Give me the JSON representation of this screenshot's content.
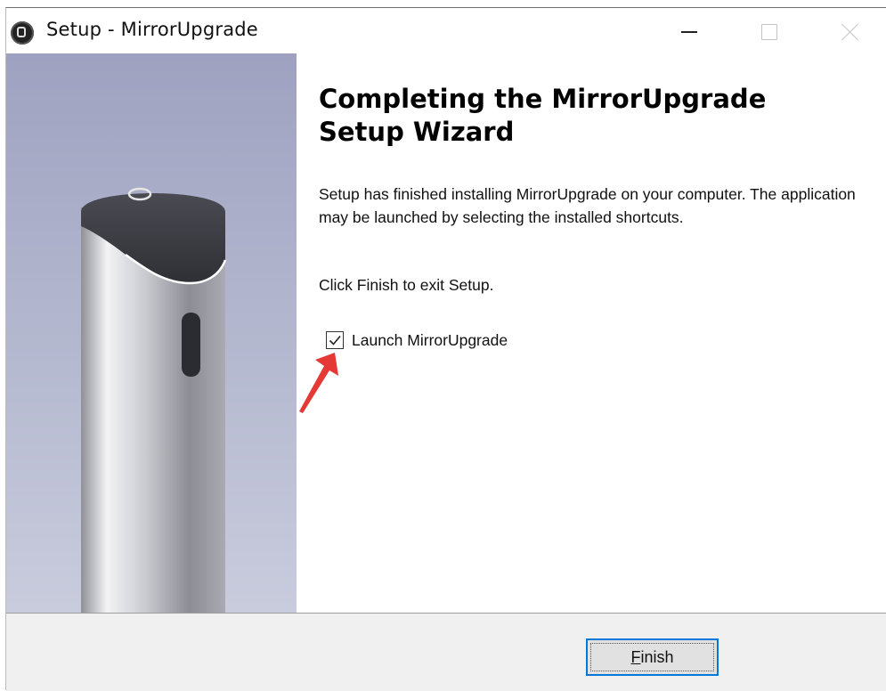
{
  "window": {
    "title": "Setup - MirrorUpgrade",
    "app_icon": "setup-app-icon",
    "controls": [
      "minimize-icon",
      "maximize-icon",
      "close-icon"
    ]
  },
  "main": {
    "heading": "Completing the MirrorUpgrade Setup Wizard",
    "body": "Setup has finished installing MirrorUpgrade on your computer. The application may be launched by selecting the installed shortcuts.",
    "exit_instruction": "Click Finish to exit Setup.",
    "launch_checkbox": {
      "label": "Launch MirrorUpgrade",
      "checked": true
    }
  },
  "footer": {
    "finish_accel": "F",
    "finish_rest": "inish"
  },
  "colors": {
    "accent": "#0078d7",
    "arrow": "#e53935",
    "footer_bg": "#f0f0f0"
  }
}
